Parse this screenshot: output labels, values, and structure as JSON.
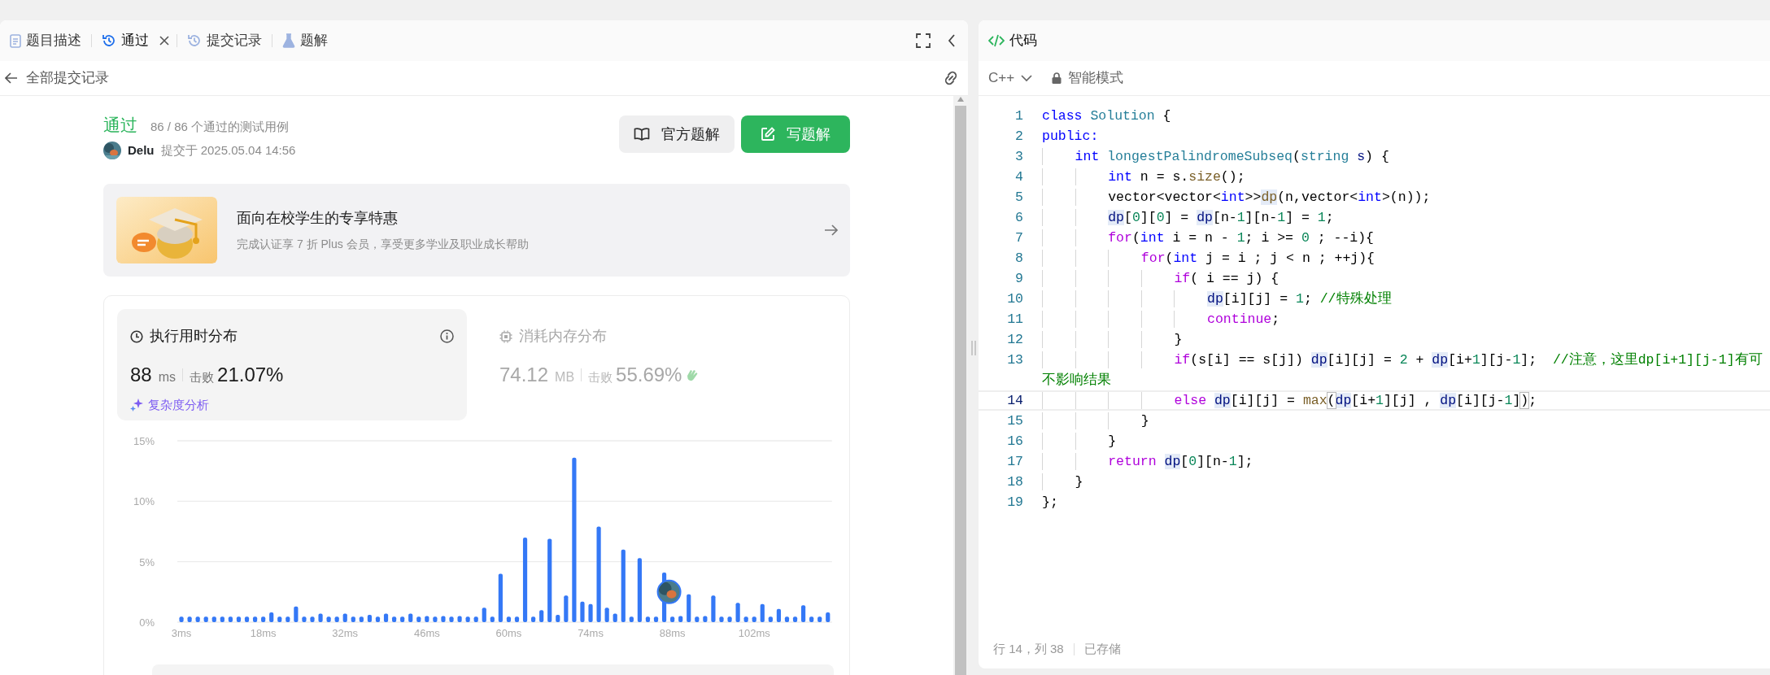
{
  "left_panel": {
    "tabs": [
      {
        "label": "题目描述",
        "selected": false,
        "closable": false
      },
      {
        "label": "通过",
        "selected": true,
        "closable": true
      },
      {
        "label": "提交记录",
        "selected": false,
        "closable": false
      },
      {
        "label": "题解",
        "selected": false,
        "closable": false
      }
    ],
    "back_link": "全部提交记录",
    "submission": {
      "status": "通过",
      "cases": "86 / 86 个通过的测试用例",
      "user": "Delu",
      "submitted": "提交于 2025.05.04 14:56"
    },
    "buttons": [
      {
        "label": "官方题解",
        "kind": "secondary"
      },
      {
        "label": "写题解",
        "kind": "primary"
      }
    ],
    "promo": {
      "title": "面向在校学生的专享特惠",
      "subtitle": "完成认证享 7 折 Plus 会员，享受更多学业及职业成长帮助"
    },
    "metrics": [
      {
        "title": "执行用时分布",
        "value": "88",
        "unit": "ms",
        "beats_label": "击败",
        "beats": "21.07%",
        "selected": true,
        "link": "复杂度分析"
      },
      {
        "title": "消耗内存分布",
        "value": "74.12",
        "unit": "MB",
        "beats_label": "击败",
        "beats": "55.69%",
        "selected": false
      }
    ],
    "chart_data": {
      "type": "bar",
      "categories": [
        "3ms",
        null,
        null,
        null,
        null,
        null,
        null,
        null,
        null,
        null,
        "18ms",
        null,
        null,
        null,
        null,
        null,
        null,
        null,
        null,
        null,
        "32ms",
        null,
        null,
        null,
        null,
        null,
        null,
        null,
        null,
        null,
        "46ms",
        null,
        null,
        null,
        null,
        null,
        null,
        null,
        null,
        null,
        "60ms",
        null,
        null,
        null,
        null,
        null,
        null,
        null,
        null,
        null,
        "74ms",
        null,
        null,
        null,
        null,
        null,
        null,
        null,
        null,
        null,
        "88ms",
        null,
        null,
        null,
        null,
        null,
        null,
        null,
        null,
        null,
        "102ms",
        null,
        null,
        null,
        null,
        null,
        null,
        null,
        null,
        null
      ],
      "series": [
        {
          "color": "#3478f6",
          "values": [
            0.45,
            0.45,
            0.45,
            0.45,
            0.45,
            0.45,
            0.45,
            0.45,
            0.45,
            0.45,
            0.45,
            0.8,
            0.45,
            0.45,
            1.3,
            0.45,
            0.45,
            0.7,
            0.45,
            0.45,
            0.7,
            0.45,
            0.45,
            0.6,
            0.45,
            0.7,
            0.45,
            0.45,
            0.7,
            0.45,
            0.5,
            0.45,
            0.5,
            0.45,
            0.5,
            0.45,
            0.45,
            1.2,
            0.45,
            4.0,
            0.45,
            0.45,
            7.0,
            0.45,
            1.0,
            6.9,
            0.6,
            2.2,
            13.6,
            1.7,
            1.5,
            7.9,
            1.2,
            0.7,
            6.0,
            0.45,
            5.3,
            0.45,
            0.45,
            4.1,
            0.45,
            0.5,
            2.3,
            0.45,
            0.5,
            2.2,
            0.45,
            0.45,
            1.6,
            0.45,
            0.45,
            1.5,
            0.45,
            1.1,
            0.45,
            0.45,
            1.4,
            0.45,
            0.45,
            0.8
          ]
        }
      ],
      "ylim": [
        0,
        15
      ],
      "yticks": [
        {
          "value": 0,
          "label": "0%"
        },
        {
          "value": 5,
          "label": "5%"
        },
        {
          "value": 10,
          "label": "10%"
        },
        {
          "value": 15,
          "label": "15%"
        }
      ]
    }
  },
  "editor": {
    "title": "代码",
    "language": "C++",
    "mode": "智能模式",
    "lines": [
      {
        "number": "1",
        "current": false,
        "tokens": [
          {
            "kind": "keyword",
            "text": "class "
          },
          {
            "kind": "type",
            "text": "Solution"
          },
          {
            "kind": "plain",
            "text": " {"
          }
        ]
      },
      {
        "number": "2",
        "current": false,
        "tokens": [
          {
            "kind": "keyword",
            "text": "public:"
          }
        ]
      },
      {
        "number": "3",
        "current": false,
        "tokens": [
          {
            "kind": "keyword",
            "text": "    int "
          },
          {
            "kind": "type",
            "text": "longestPalindromeSubseq"
          },
          {
            "kind": "plain",
            "text": "("
          },
          {
            "kind": "type",
            "text": "string "
          },
          {
            "kind": "variable",
            "text": "s"
          },
          {
            "kind": "plain",
            "text": ") {"
          }
        ]
      },
      {
        "number": "4",
        "current": false,
        "tokens": [
          {
            "kind": "keyword",
            "text": "        int"
          },
          {
            "kind": "plain",
            "text": " n = s."
          },
          {
            "kind": "function",
            "text": "size"
          },
          {
            "kind": "plain",
            "text": "();"
          }
        ]
      },
      {
        "number": "5",
        "current": false,
        "tokens": [
          {
            "kind": "plain",
            "text": "        vector<vector<"
          },
          {
            "kind": "keyword",
            "text": "int"
          },
          {
            "kind": "plain",
            "text": ">>"
          },
          {
            "kind": "highlight-function",
            "text": "dp"
          },
          {
            "kind": "plain",
            "text": "(n,vector<"
          },
          {
            "kind": "keyword",
            "text": "int"
          },
          {
            "kind": "plain",
            "text": ">(n));"
          }
        ]
      },
      {
        "number": "6",
        "current": false,
        "tokens": [
          {
            "kind": "highlight",
            "text": "        dp"
          },
          {
            "kind": "plain",
            "text": "["
          },
          {
            "kind": "number",
            "text": "0"
          },
          {
            "kind": "plain",
            "text": "]["
          },
          {
            "kind": "number",
            "text": "0"
          },
          {
            "kind": "plain",
            "text": "] = "
          },
          {
            "kind": "highlight",
            "text": "dp"
          },
          {
            "kind": "plain",
            "text": "[n-"
          },
          {
            "kind": "number",
            "text": "1"
          },
          {
            "kind": "plain",
            "text": "][n-"
          },
          {
            "kind": "number",
            "text": "1"
          },
          {
            "kind": "plain",
            "text": "] = "
          },
          {
            "kind": "number",
            "text": "1"
          },
          {
            "kind": "plain",
            "text": ";"
          }
        ]
      },
      {
        "number": "7",
        "current": false,
        "tokens": [
          {
            "kind": "control",
            "text": "        for"
          },
          {
            "kind": "plain",
            "text": "("
          },
          {
            "kind": "keyword",
            "text": "int"
          },
          {
            "kind": "plain",
            "text": " i = n - "
          },
          {
            "kind": "number",
            "text": "1"
          },
          {
            "kind": "plain",
            "text": "; i >= "
          },
          {
            "kind": "number",
            "text": "0"
          },
          {
            "kind": "plain",
            "text": " ; --i){"
          }
        ]
      },
      {
        "number": "8",
        "current": false,
        "tokens": [
          {
            "kind": "control",
            "text": "            for"
          },
          {
            "kind": "plain",
            "text": "("
          },
          {
            "kind": "keyword",
            "text": "int"
          },
          {
            "kind": "plain",
            "text": " j = i ; j < n ; ++j){"
          }
        ]
      },
      {
        "number": "9",
        "current": false,
        "tokens": [
          {
            "kind": "control",
            "text": "                if"
          },
          {
            "kind": "plain",
            "text": "( i == j) {"
          }
        ]
      },
      {
        "number": "10",
        "current": false,
        "tokens": [
          {
            "kind": "highlight",
            "text": "                    dp"
          },
          {
            "kind": "plain",
            "text": "[i][j] = "
          },
          {
            "kind": "number",
            "text": "1"
          },
          {
            "kind": "plain",
            "text": "; "
          },
          {
            "kind": "comment",
            "text": "//特殊处理"
          }
        ]
      },
      {
        "number": "11",
        "current": false,
        "tokens": [
          {
            "kind": "control",
            "text": "                    continue"
          },
          {
            "kind": "plain",
            "text": ";"
          }
        ]
      },
      {
        "number": "12",
        "current": false,
        "tokens": [
          {
            "kind": "plain",
            "text": "                }"
          }
        ]
      },
      {
        "number": "13",
        "current": false,
        "tokens": [
          {
            "kind": "control",
            "text": "                if"
          },
          {
            "kind": "plain",
            "text": "(s[i] == s[j]) "
          },
          {
            "kind": "highlight",
            "text": "dp"
          },
          {
            "kind": "plain",
            "text": "[i][j] = "
          },
          {
            "kind": "number",
            "text": "2"
          },
          {
            "kind": "plain",
            "text": " + "
          },
          {
            "kind": "highlight",
            "text": "dp"
          },
          {
            "kind": "plain",
            "text": "[i+"
          },
          {
            "kind": "number",
            "text": "1"
          },
          {
            "kind": "plain",
            "text": "][j-"
          },
          {
            "kind": "number",
            "text": "1"
          },
          {
            "kind": "plain",
            "text": "];  "
          },
          {
            "kind": "comment",
            "text": "//注意，这里dp[i+1][j-1]有可"
          }
        ],
        "continuation": "不影响结果"
      },
      {
        "number": "14",
        "current": true,
        "tokens": [
          {
            "kind": "control",
            "text": "                else "
          },
          {
            "kind": "highlight",
            "text": "dp"
          },
          {
            "kind": "plain",
            "text": "[i][j] = "
          },
          {
            "kind": "function",
            "text": "max"
          },
          {
            "kind": "bracket",
            "text": "("
          },
          {
            "kind": "highlight",
            "text": "dp"
          },
          {
            "kind": "plain",
            "text": "[i+"
          },
          {
            "kind": "number",
            "text": "1"
          },
          {
            "kind": "plain",
            "text": "][j] , "
          },
          {
            "kind": "highlight",
            "text": "dp"
          },
          {
            "kind": "plain",
            "text": "[i][j-"
          },
          {
            "kind": "number",
            "text": "1"
          },
          {
            "kind": "plain",
            "text": "]"
          },
          {
            "kind": "bracket",
            "text": ")"
          },
          {
            "kind": "plain",
            "text": ";"
          }
        ]
      },
      {
        "number": "15",
        "current": false,
        "tokens": [
          {
            "kind": "plain",
            "text": "            }"
          }
        ]
      },
      {
        "number": "16",
        "current": false,
        "tokens": [
          {
            "kind": "plain",
            "text": "        }"
          }
        ]
      },
      {
        "number": "17",
        "current": false,
        "tokens": [
          {
            "kind": "control",
            "text": "        return "
          },
          {
            "kind": "highlight",
            "text": "dp"
          },
          {
            "kind": "plain",
            "text": "["
          },
          {
            "kind": "number",
            "text": "0"
          },
          {
            "kind": "plain",
            "text": "][n-"
          },
          {
            "kind": "number",
            "text": "1"
          },
          {
            "kind": "plain",
            "text": "];"
          }
        ]
      },
      {
        "number": "18",
        "current": false,
        "tokens": [
          {
            "kind": "plain",
            "text": "    }"
          }
        ]
      },
      {
        "number": "19",
        "current": false,
        "tokens": [
          {
            "kind": "plain",
            "text": "};"
          }
        ]
      }
    ],
    "status": {
      "position": "行 14，列 38",
      "saved": "已存储"
    }
  }
}
